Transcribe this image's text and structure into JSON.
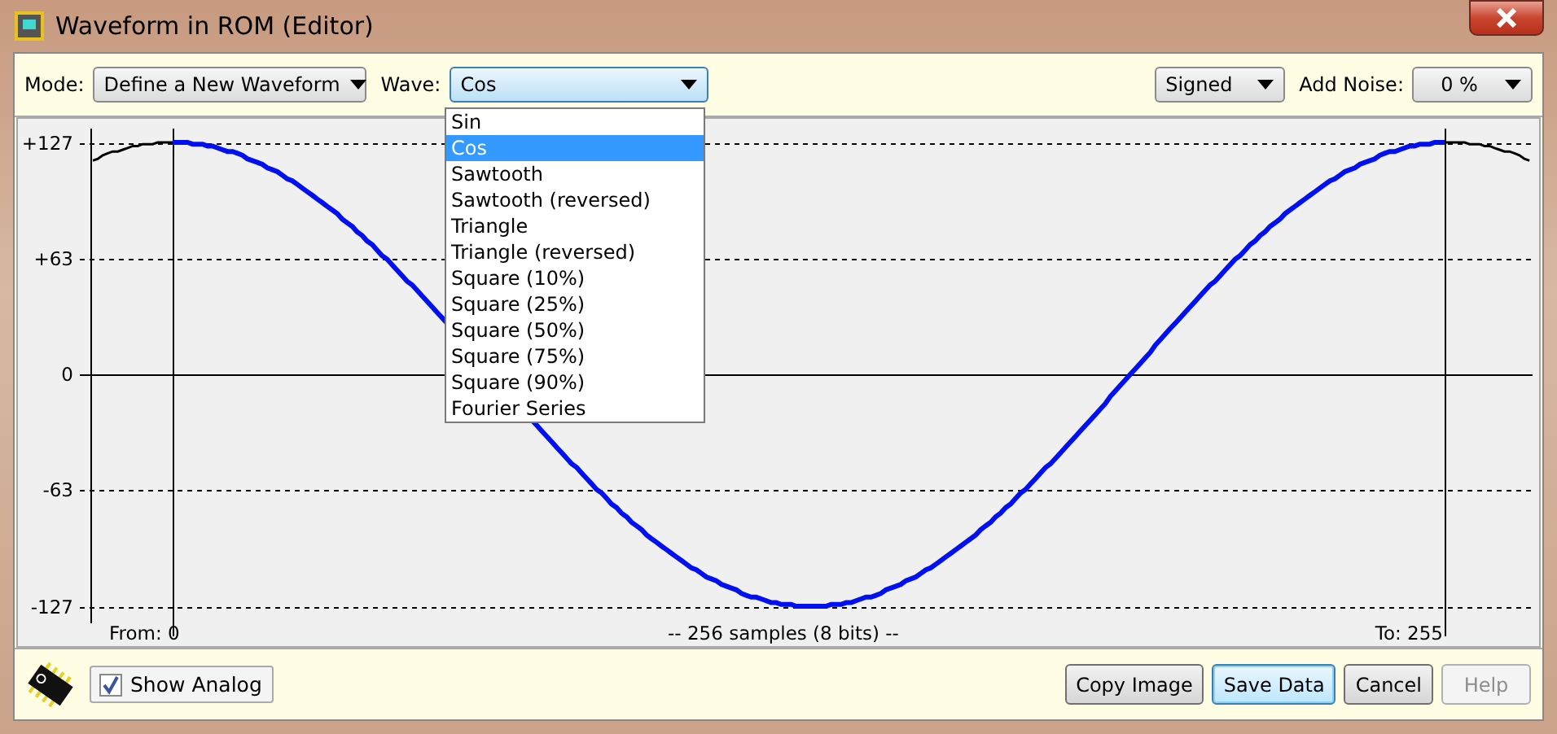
{
  "window": {
    "title": "Waveform in ROM (Editor)"
  },
  "toolbar": {
    "mode_label": "Mode:",
    "mode_value": "Define a New Waveform",
    "wave_label": "Wave:",
    "wave_value": "Cos",
    "sign_value": "Signed",
    "noise_label": "Add Noise:",
    "noise_value": "0 %"
  },
  "wave_menu": [
    {
      "label": "Sin",
      "selected": false
    },
    {
      "label": "Cos",
      "selected": true
    },
    {
      "label": "Sawtooth",
      "selected": false
    },
    {
      "label": "Sawtooth (reversed)",
      "selected": false
    },
    {
      "label": "Triangle",
      "selected": false
    },
    {
      "label": "Triangle (reversed)",
      "selected": false
    },
    {
      "label": "Square (10%)",
      "selected": false
    },
    {
      "label": "Square (25%)",
      "selected": false
    },
    {
      "label": "Square (50%)",
      "selected": false
    },
    {
      "label": "Square (75%)",
      "selected": false
    },
    {
      "label": "Square (90%)",
      "selected": false
    },
    {
      "label": "Fourier Series",
      "selected": false
    }
  ],
  "plot": {
    "y_labels": [
      "+127",
      "+63",
      "0",
      "-63",
      "-127"
    ],
    "from_label": "From: 0",
    "info": "-- 256 samples (8 bits) --",
    "to_label": "To: 255"
  },
  "bottom": {
    "show_analog": {
      "label": "Show Analog",
      "checked": true
    },
    "buttons": [
      {
        "label": "Copy Image",
        "kind": "normal"
      },
      {
        "label": "Save Data",
        "kind": "default"
      },
      {
        "label": "Cancel",
        "kind": "normal"
      },
      {
        "label": "Help",
        "kind": "disabled"
      }
    ]
  }
}
